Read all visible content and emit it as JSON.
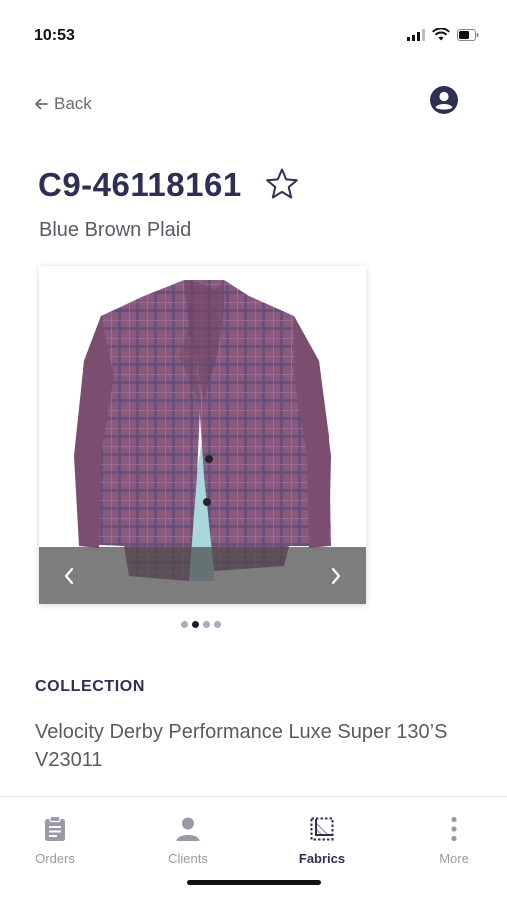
{
  "status_bar": {
    "time": "10:53",
    "icons": [
      "cellular-signal-icon",
      "wifi-icon",
      "battery-icon"
    ]
  },
  "header": {
    "back_label": "Back",
    "back_icon": "arrow-left-icon",
    "account_icon": "user-circle-icon"
  },
  "product": {
    "code": "C9-46118161",
    "name": "Blue Brown Plaid",
    "favorite_icon": "star-outline-icon"
  },
  "carousel": {
    "image": "plaid-blazer-photo",
    "prev_icon": "chevron-left-icon",
    "next_icon": "chevron-right-icon",
    "slide_count": 4,
    "active_index": 1
  },
  "collection": {
    "label": "COLLECTION",
    "value": "Velocity Derby Performance Luxe Super 130’S V23011"
  },
  "tab_bar": {
    "tabs": [
      {
        "label": "Orders",
        "icon": "clipboard-icon",
        "active": false
      },
      {
        "label": "Clients",
        "icon": "person-icon",
        "active": false
      },
      {
        "label": "Fabrics",
        "icon": "fabric-swatch-icon",
        "active": true
      },
      {
        "label": "More",
        "icon": "more-vertical-icon",
        "active": false
      }
    ]
  },
  "colors": {
    "primary": "#2e3053",
    "secondary_text": "#5a5a66",
    "inactive_tab": "#9a9aa6",
    "dot_inactive": "#a9a9c3",
    "dot_active": "#1c1c2a"
  }
}
